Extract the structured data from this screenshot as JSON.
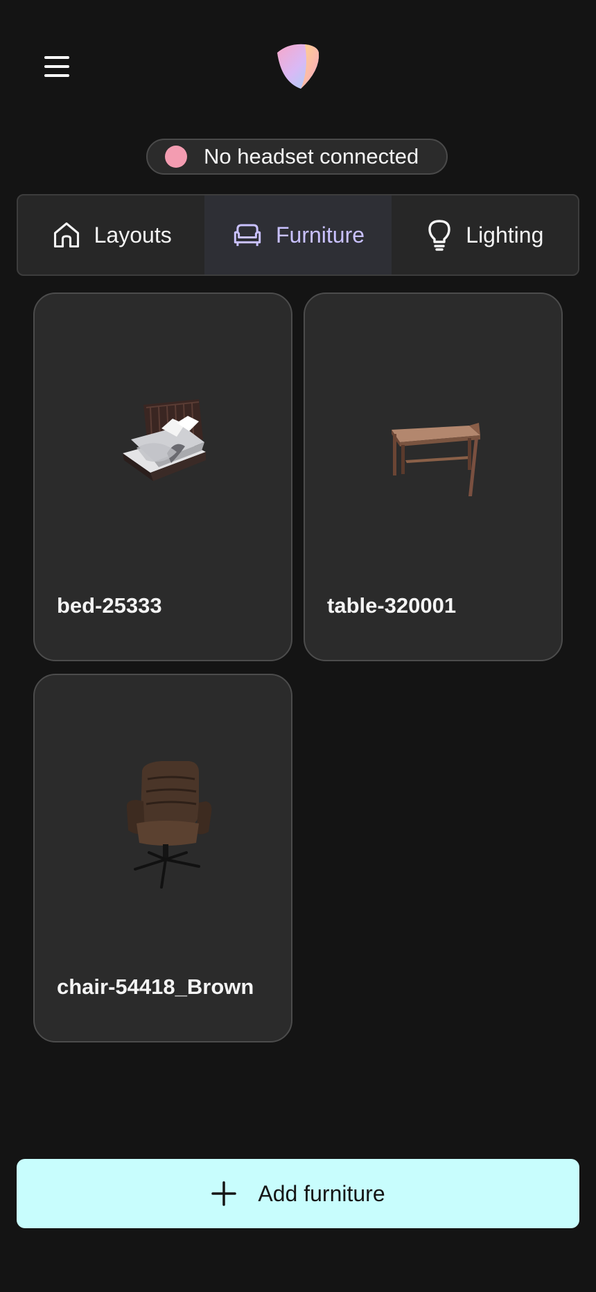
{
  "header": {
    "menu_icon": "hamburger-menu-icon",
    "logo": "app-logo-gradient-shield"
  },
  "status": {
    "text": "No headset connected",
    "dot_color": "#f39cb1"
  },
  "tabs": [
    {
      "label": "Layouts",
      "icon": "home-icon",
      "active": false
    },
    {
      "label": "Furniture",
      "icon": "sofa-icon",
      "active": true
    },
    {
      "label": "Lighting",
      "icon": "lightbulb-icon",
      "active": false
    }
  ],
  "colors": {
    "background": "#141414",
    "card": "#2b2b2b",
    "active_tab_text": "#c9c1ff",
    "primary_button": "#c8fdfd"
  },
  "furniture": [
    {
      "name": "bed-25333",
      "thumbnail": "bed-thumbnail"
    },
    {
      "name": "table-320001",
      "thumbnail": "table-thumbnail"
    },
    {
      "name": "chair-54418_Brown",
      "thumbnail": "chair-thumbnail"
    }
  ],
  "actions": {
    "add_label": "Add furniture",
    "add_icon": "plus-icon"
  }
}
